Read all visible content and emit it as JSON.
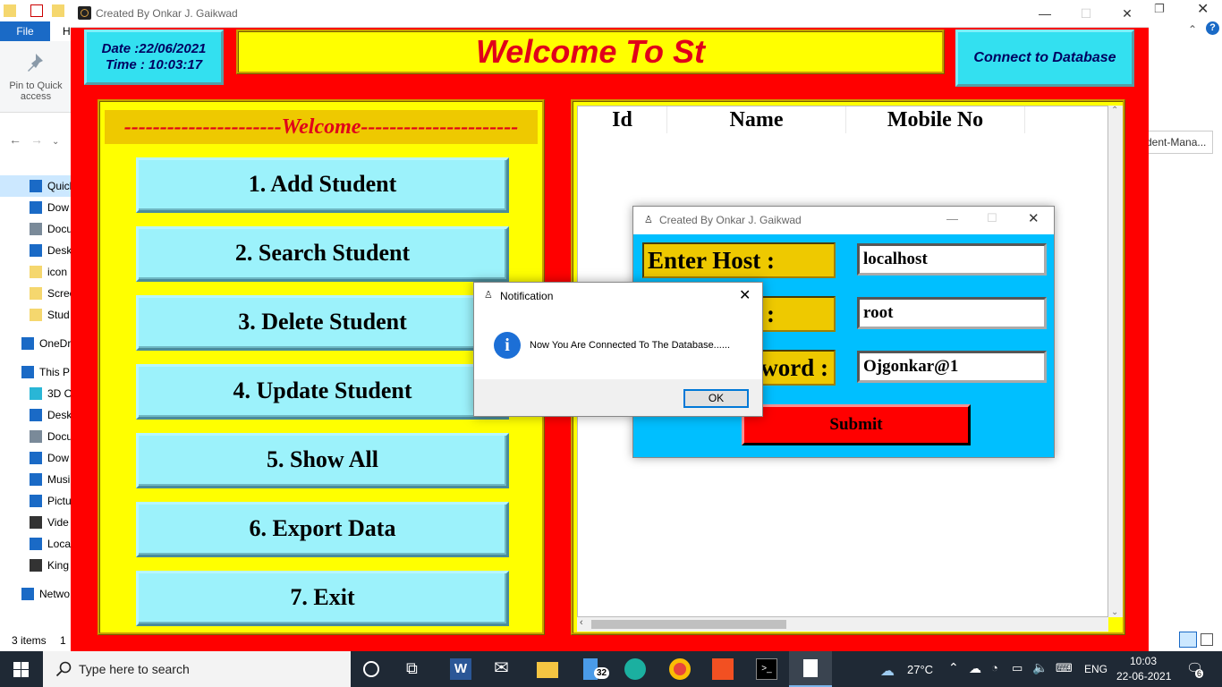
{
  "explorer": {
    "file_tab": "File",
    "home_tab_partial": "H",
    "pin_label": "Pin to Quick access",
    "breadcrumb_partial": "dent-Mana...",
    "tree": [
      {
        "label": "Quick",
        "icon": "star-icon",
        "color": "#1a6ac6",
        "selected": true
      },
      {
        "label": "Dow",
        "icon": "download-icon",
        "color": "#1a6ac6"
      },
      {
        "label": "Docu",
        "icon": "document-icon",
        "color": "#7a8a99"
      },
      {
        "label": "Desk",
        "icon": "desktop-icon",
        "color": "#1a6ac6"
      },
      {
        "label": "icon",
        "icon": "folder-icon",
        "color": "#f5d76e"
      },
      {
        "label": "Scree",
        "icon": "folder-icon",
        "color": "#f5d76e"
      },
      {
        "label": "Stud",
        "icon": "folder-icon",
        "color": "#f5d76e"
      },
      {
        "label": "OneDr",
        "icon": "cloud-icon",
        "color": "#1a6ac6"
      },
      {
        "label": "This P",
        "icon": "computer-icon",
        "color": "#1a6ac6"
      },
      {
        "label": "3D O",
        "icon": "cube-icon",
        "color": "#29b6d6"
      },
      {
        "label": "Desk",
        "icon": "desktop-icon",
        "color": "#1a6ac6"
      },
      {
        "label": "Docu",
        "icon": "document-icon",
        "color": "#7a8a99"
      },
      {
        "label": "Dow",
        "icon": "download-icon",
        "color": "#1a6ac6"
      },
      {
        "label": "Musi",
        "icon": "music-icon",
        "color": "#1a6ac6"
      },
      {
        "label": "Pictu",
        "icon": "pictures-icon",
        "color": "#1a6ac6"
      },
      {
        "label": "Vide",
        "icon": "video-icon",
        "color": "#333"
      },
      {
        "label": "Loca",
        "icon": "drive-icon",
        "color": "#1a6ac6"
      },
      {
        "label": "King",
        "icon": "drive-icon",
        "color": "#333"
      },
      {
        "label": "Netwo",
        "icon": "network-icon",
        "color": "#1a6ac6"
      }
    ],
    "status": "3 items",
    "status_extra": "1"
  },
  "app": {
    "title": "Created By Onkar J. Gaikwad",
    "date_line": "Date :22/06/2021",
    "time_line": "Time : 10:03:17",
    "welcome_title": "Welcome To St",
    "connect_button": "Connect to Database",
    "welcome_banner": "----------------------Welcome----------------------",
    "menu": [
      "1. Add Student",
      "2. Search Student",
      "3. Delete Student",
      "4. Update Student",
      "5. Show All",
      "6. Export Data",
      "7. Exit"
    ],
    "table_headers": [
      "Id",
      "Name",
      "Mobile No"
    ]
  },
  "db_dialog": {
    "title": "Created By Onkar J. Gaikwad",
    "host_label": "Enter Host :",
    "user_label_partial": ":",
    "pass_label_partial": "word :",
    "host_value": "localhost",
    "user_value": "root",
    "pass_value": "Ojgonkar@1",
    "submit": "Submit"
  },
  "notification": {
    "title": "Notification",
    "message": "Now You Are Connected To The Database......",
    "ok": "OK"
  },
  "taskbar": {
    "search_placeholder": "Type here to search",
    "badge_count": "32",
    "weather": "27°C",
    "language": "ENG",
    "time": "10:03",
    "date": "22-06-2021",
    "notifications_count": "6"
  }
}
